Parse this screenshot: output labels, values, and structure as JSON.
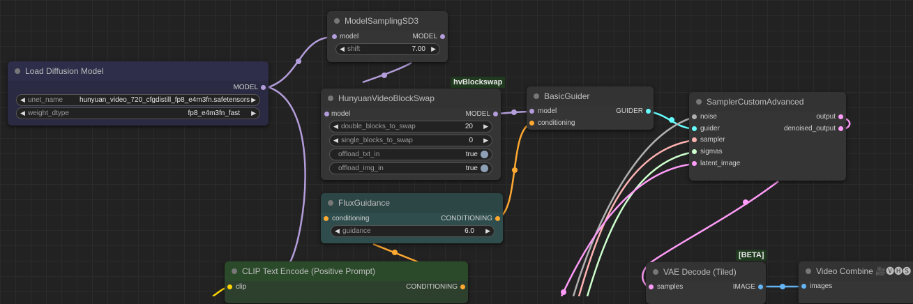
{
  "nodes": {
    "load_diffusion": {
      "title": "Load Diffusion Model",
      "output_model": "MODEL",
      "unet_name_label": "unet_name",
      "unet_name_value": "hunyuan_video_720_cfgdistill_fp8_e4m3fn.safetensors",
      "weight_dtype_label": "weight_dtype",
      "weight_dtype_value": "fp8_e4m3fn_fast"
    },
    "model_sampling": {
      "title": "ModelSamplingSD3",
      "input_model": "model",
      "output_model": "MODEL",
      "shift_label": "shift",
      "shift_value": "7.00"
    },
    "block_swap": {
      "badge": "hvBlockswap",
      "title": "HunyuanVideoBlockSwap",
      "input_model": "model",
      "output_model": "MODEL",
      "double_label": "double_blocks_to_swap",
      "double_value": "20",
      "single_label": "single_blocks_to_swap",
      "single_value": "0",
      "offload_txt_label": "offload_txt_in",
      "offload_txt_value": "true",
      "offload_img_label": "offload_img_in",
      "offload_img_value": "true"
    },
    "basic_guider": {
      "title": "BasicGuider",
      "input_model": "model",
      "input_conditioning": "conditioning",
      "output_guider": "GUIDER"
    },
    "sampler_custom": {
      "title": "SamplerCustomAdvanced",
      "in_noise": "noise",
      "in_guider": "guider",
      "in_sampler": "sampler",
      "in_sigmas": "sigmas",
      "in_latent": "latent_image",
      "out_output": "output",
      "out_denoised": "denoised_output"
    },
    "flux_guidance": {
      "title": "FluxGuidance",
      "input_conditioning": "conditioning",
      "output_conditioning": "CONDITIONING",
      "guidance_label": "guidance",
      "guidance_value": "6.0"
    },
    "clip_text": {
      "title": "CLIP Text Encode (Positive Prompt)",
      "input_clip": "clip",
      "output_conditioning": "CONDITIONING"
    },
    "vae_decode": {
      "badge": "[BETA]",
      "title": "VAE Decode (Tiled)",
      "input_samples": "samples",
      "output_image": "IMAGE"
    },
    "video_combine": {
      "title": "Video Combine 🎥🅥🅗🅢",
      "input_images": "images"
    }
  },
  "colors": {
    "model": "#b39ddb",
    "conditioning": "#ffa931",
    "guider": "#66ffff",
    "sampler": "#ffb3b3",
    "sigmas": "#cdffcd",
    "latent": "#ff9cf9",
    "image": "#64b5f6",
    "noise": "#b0b0b0",
    "clip": "#ffd500"
  }
}
